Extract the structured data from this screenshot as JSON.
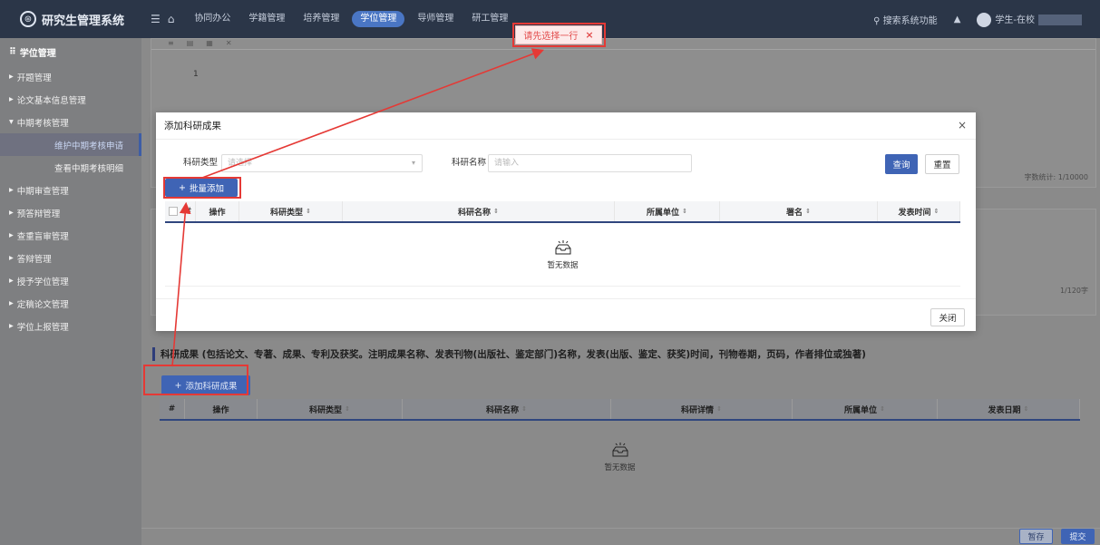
{
  "topbar": {
    "app_title": "研究生管理系统",
    "nav": [
      "协同办公",
      "学籍管理",
      "培养管理",
      "学位管理",
      "导师管理",
      "研工管理"
    ],
    "active_nav_index": 3,
    "search_label": "搜索系统功能",
    "user_label": "学生-在校"
  },
  "toast": {
    "text": "请先选择一行",
    "close": "×"
  },
  "sidebar": {
    "header": "学位管理",
    "items": [
      {
        "label": "开题管理"
      },
      {
        "label": "论文基本信息管理"
      },
      {
        "label": "中期考核管理",
        "open": true,
        "children": [
          "维护中期考核申请",
          "查看中期考核明细"
        ],
        "active_child": 0
      },
      {
        "label": "中期审查管理"
      },
      {
        "label": "预答辩管理"
      },
      {
        "label": "查重盲审管理"
      },
      {
        "label": "答辩管理"
      },
      {
        "label": "授予学位管理"
      },
      {
        "label": "定稿论文管理"
      },
      {
        "label": "学位上报管理"
      }
    ]
  },
  "editor": {
    "line_number": "1",
    "word_count": "字数统计: 1/10000",
    "count2": "1/120字"
  },
  "results": {
    "title": "科研成果 (包括论文、专著、成果、专利及获奖。注明成果名称、发表刊物(出版社、鉴定部门)名称，发表(出版、鉴定、获奖)时间，刊物卷期，页码，作者排位或独著)",
    "add_button": "添加科研成果",
    "columns": [
      "#",
      "操作",
      "科研类型",
      "科研名称",
      "科研详情",
      "所属单位",
      "发表日期"
    ],
    "empty_text": "暂无数据"
  },
  "footer": {
    "save": "暂存",
    "submit": "提交"
  },
  "modal": {
    "title": "添加科研成果",
    "close_icon": "×",
    "type_label": "科研类型",
    "type_placeholder": "请选择",
    "name_label": "科研名称",
    "name_placeholder": "请输入",
    "query": "查询",
    "reset": "重置",
    "batch_add": "批量添加",
    "columns": [
      "#",
      "操作",
      "科研类型",
      "科研名称",
      "所属单位",
      "署名",
      "发表时间"
    ],
    "empty_text": "暂无数据",
    "close_button": "关闭"
  },
  "colors": {
    "primary": "#3f64b5",
    "header_bg": "#2b3648",
    "annotation": "#e53935",
    "toast_text": "#e24c4c"
  }
}
